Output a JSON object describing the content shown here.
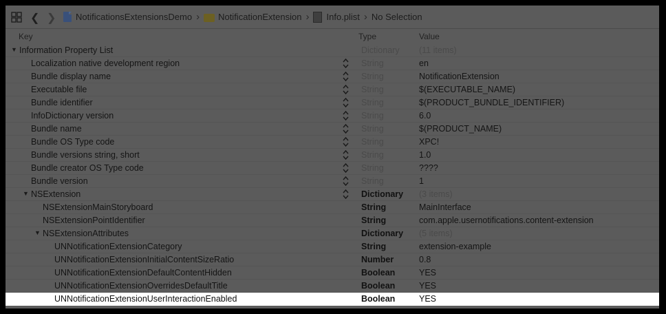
{
  "jumpbar": {
    "crumbs": [
      "NotificationsExtensionsDemo",
      "NotificationExtension",
      "Info.plist",
      "No Selection"
    ]
  },
  "columns": {
    "key": "Key",
    "type": "Type",
    "value": "Value"
  },
  "rows": [
    {
      "key": "Information Property List",
      "type": "Dictionary",
      "value": "(11 items)",
      "indent": 0,
      "expander": "open",
      "stepper": false,
      "type_style": "dim",
      "value_style": "dim"
    },
    {
      "key": "Localization native development region",
      "type": "String",
      "value": "en",
      "indent": 1,
      "expander": "none",
      "stepper": true,
      "type_style": "dim",
      "value_style": "normal"
    },
    {
      "key": "Bundle display name",
      "type": "String",
      "value": "NotificationExtension",
      "indent": 1,
      "expander": "none",
      "stepper": true,
      "type_style": "dim",
      "value_style": "normal"
    },
    {
      "key": "Executable file",
      "type": "String",
      "value": "$(EXECUTABLE_NAME)",
      "indent": 1,
      "expander": "none",
      "stepper": true,
      "type_style": "dim",
      "value_style": "normal"
    },
    {
      "key": "Bundle identifier",
      "type": "String",
      "value": "$(PRODUCT_BUNDLE_IDENTIFIER)",
      "indent": 1,
      "expander": "none",
      "stepper": true,
      "type_style": "dim",
      "value_style": "normal"
    },
    {
      "key": "InfoDictionary version",
      "type": "String",
      "value": "6.0",
      "indent": 1,
      "expander": "none",
      "stepper": true,
      "type_style": "dim",
      "value_style": "normal"
    },
    {
      "key": "Bundle name",
      "type": "String",
      "value": "$(PRODUCT_NAME)",
      "indent": 1,
      "expander": "none",
      "stepper": true,
      "type_style": "dim",
      "value_style": "normal"
    },
    {
      "key": "Bundle OS Type code",
      "type": "String",
      "value": "XPC!",
      "indent": 1,
      "expander": "none",
      "stepper": true,
      "type_style": "dim",
      "value_style": "normal"
    },
    {
      "key": "Bundle versions string, short",
      "type": "String",
      "value": "1.0",
      "indent": 1,
      "expander": "none",
      "stepper": true,
      "type_style": "dim",
      "value_style": "normal"
    },
    {
      "key": "Bundle creator OS Type code",
      "type": "String",
      "value": "????",
      "indent": 1,
      "expander": "none",
      "stepper": true,
      "type_style": "dim",
      "value_style": "normal"
    },
    {
      "key": "Bundle version",
      "type": "String",
      "value": "1",
      "indent": 1,
      "expander": "none",
      "stepper": true,
      "type_style": "dim",
      "value_style": "normal"
    },
    {
      "key": "NSExtension",
      "type": "Dictionary",
      "value": "(3 items)",
      "indent": 1,
      "expander": "open",
      "stepper": true,
      "type_style": "bold",
      "value_style": "dim"
    },
    {
      "key": "NSExtensionMainStoryboard",
      "type": "String",
      "value": "MainInterface",
      "indent": 2,
      "expander": "none",
      "stepper": false,
      "type_style": "bold",
      "value_style": "normal"
    },
    {
      "key": "NSExtensionPointIdentifier",
      "type": "String",
      "value": "com.apple.usernotifications.content-extension",
      "indent": 2,
      "expander": "none",
      "stepper": false,
      "type_style": "bold",
      "value_style": "normal"
    },
    {
      "key": "NSExtensionAttributes",
      "type": "Dictionary",
      "value": "(5 items)",
      "indent": 2,
      "expander": "open",
      "stepper": false,
      "type_style": "bold",
      "value_style": "dim"
    },
    {
      "key": "UNNotificationExtensionCategory",
      "type": "String",
      "value": "extension-example",
      "indent": 3,
      "expander": "none",
      "stepper": false,
      "type_style": "bold",
      "value_style": "normal"
    },
    {
      "key": "UNNotificationExtensionInitialContentSizeRatio",
      "type": "Number",
      "value": "0.8",
      "indent": 3,
      "expander": "none",
      "stepper": false,
      "type_style": "bold",
      "value_style": "normal"
    },
    {
      "key": "UNNotificationExtensionDefaultContentHidden",
      "type": "Boolean",
      "value": "YES",
      "indent": 3,
      "expander": "none",
      "stepper": false,
      "type_style": "bold",
      "value_style": "normal"
    },
    {
      "key": "UNNotificationExtensionOverridesDefaultTitle",
      "type": "Boolean",
      "value": "YES",
      "indent": 3,
      "expander": "none",
      "stepper": false,
      "type_style": "bold",
      "value_style": "normal"
    },
    {
      "key": "UNNotificationExtensionUserInteractionEnabled",
      "type": "Boolean",
      "value": "YES",
      "indent": 3,
      "expander": "none",
      "stepper": false,
      "type_style": "bold",
      "value_style": "normal",
      "selected": true
    }
  ]
}
